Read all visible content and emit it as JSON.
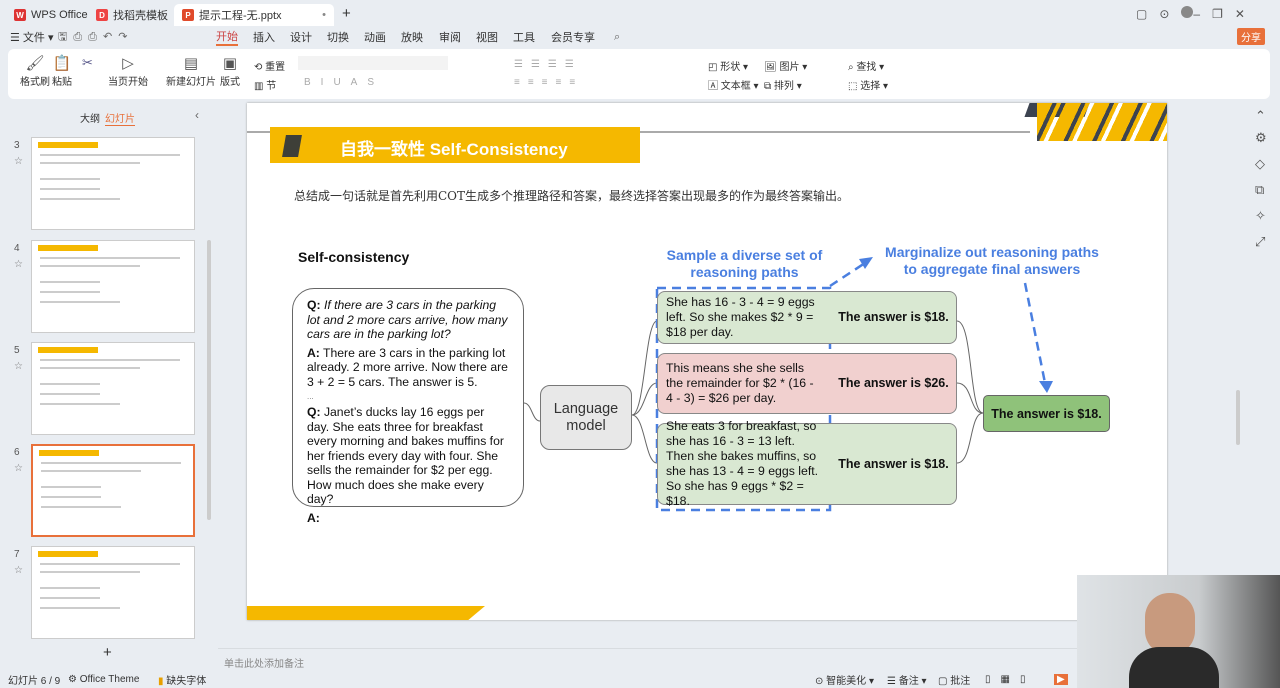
{
  "titlebar": {
    "tabs": [
      {
        "label": "WPS Office"
      },
      {
        "label": "找稻壳模板"
      },
      {
        "label": "提示工程-无.pptx"
      }
    ],
    "new_tab": "+",
    "share": "分享"
  },
  "menu": {
    "file": "文件",
    "items": [
      "开始",
      "插入",
      "设计",
      "切换",
      "动画",
      "放映",
      "审阅",
      "视图",
      "工具",
      "会员专享"
    ],
    "active": "开始"
  },
  "ribbon": {
    "format_painter": "格式刷",
    "paste": "粘贴",
    "play_from_current": "当页开始",
    "new_slide": "新建幻灯片",
    "layout": "版式",
    "reset": "重置",
    "section": "节",
    "shape": "形状",
    "picture": "图片",
    "textbox": "文本框",
    "arrange": "排列",
    "find": "查找",
    "select": "选择"
  },
  "sidebar": {
    "tabs": [
      "大纲",
      "幻灯片"
    ],
    "active_tab": "幻灯片",
    "slides": [
      {
        "number": "3"
      },
      {
        "number": "4"
      },
      {
        "number": "5"
      },
      {
        "number": "6",
        "selected": true
      },
      {
        "number": "7"
      }
    ],
    "add": "+"
  },
  "slide": {
    "title": "自我一致性 Self-Consistency",
    "subtitle": "总结成一句话就是首先利用COT生成多个推理路径和答案，最终选择答案出现最多的作为最终答案输出。",
    "diagram_title": "Self-consistency",
    "prompt": {
      "q1_label": "Q:",
      "q1": "If there are 3 cars in the parking lot and 2 more cars arrive, how many cars are in the parking lot?",
      "a1_label": "A:",
      "a1": "There are 3 cars in the parking lot already. 2 more arrive. Now there are 3 + 2 = 5 cars. The answer is 5.",
      "ellipsis": "...",
      "q2_label": "Q:",
      "q2": "Janet’s ducks lay 16 eggs per day. She eats three for breakfast every morning and bakes muffins for her friends every day with four. She sells the remainder for $2 per egg. How much does she make every day?",
      "a2_label": "A:"
    },
    "model": "Language model",
    "sample_label": "Sample a diverse set of reasoning paths",
    "marginalize_label": "Marginalize out reasoning paths to aggregate final answers",
    "paths": [
      {
        "reasoning": "She has 16 - 3 - 4 = 9 eggs left. So she makes $2 * 9 = $18 per day.",
        "answer": "The answer is $18."
      },
      {
        "reasoning": "This means she she sells the remainder for $2 * (16 - 4 - 3) = $26 per day.",
        "answer": "The answer is $26."
      },
      {
        "reasoning": "She eats 3 for breakfast, so she has 16 - 3 = 13 left. Then she bakes muffins, so she has 13 - 4 = 9 eggs left. So she has 9 eggs * $2 = $18.",
        "answer": "The answer is $18."
      }
    ],
    "final_answer": "The answer is $18."
  },
  "notes_placeholder": "单击此处添加备注",
  "status": {
    "slide_counter": "幻灯片 6 / 9",
    "theme": "Office Theme",
    "missing_font": "缺失字体",
    "beautify": "智能美化",
    "notes": "备注",
    "comments": "批注"
  },
  "colors": {
    "accent": "#e8703a",
    "yellow": "#f5b800",
    "green": "#d9e8d2",
    "red": "#f1d0cf",
    "final_green": "#8fc27a",
    "blue": "#4a7fe0"
  }
}
